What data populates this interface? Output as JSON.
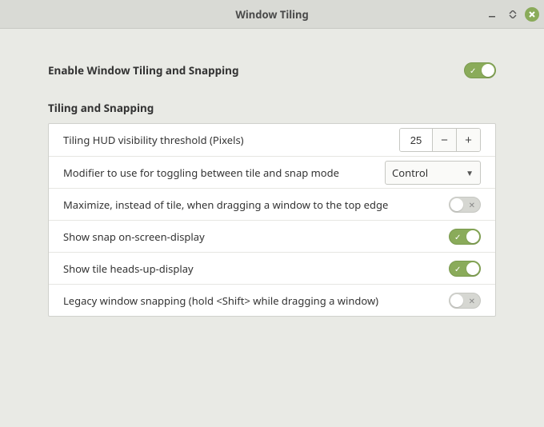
{
  "window": {
    "title": "Window Tiling"
  },
  "master": {
    "label": "Enable Window Tiling and Snapping",
    "enabled": true
  },
  "section": {
    "title": "Tiling and Snapping"
  },
  "settings": {
    "hud_threshold": {
      "label": "Tiling HUD visibility threshold (Pixels)",
      "value": "25"
    },
    "modifier": {
      "label": "Modifier to use for toggling between tile and snap mode",
      "value": "Control"
    },
    "maximize_top": {
      "label": "Maximize, instead of tile, when dragging a window to the top edge",
      "value": false
    },
    "snap_osd": {
      "label": "Show snap on-screen-display",
      "value": true
    },
    "tile_hud": {
      "label": "Show tile heads-up-display",
      "value": true
    },
    "legacy_snap": {
      "label": "Legacy window snapping (hold <Shift> while dragging a window)",
      "value": false
    }
  }
}
